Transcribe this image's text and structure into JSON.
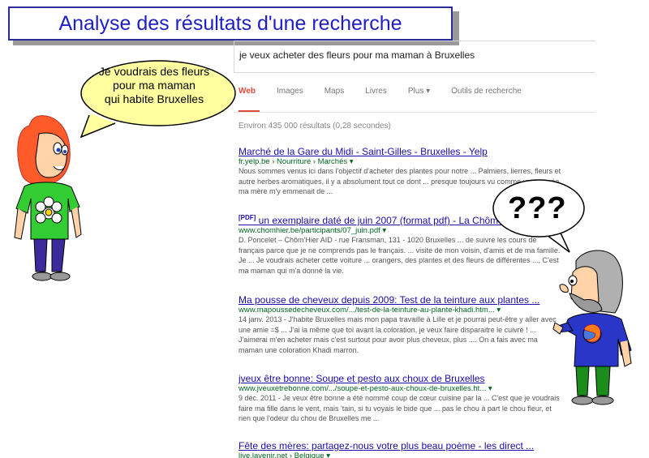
{
  "title": "Analyse des résultats d'une recherche",
  "search": {
    "query": "je veux acheter des fleurs pour ma maman à Bruxelles",
    "tabs": [
      "Web",
      "Images",
      "Maps",
      "Livres",
      "Plus ▾",
      "Outils de recherche"
    ],
    "stats": "Environ 435 000 résultats (0,28 secondes)"
  },
  "results": [
    {
      "title": "Marché de la Gare du Midi - Saint-Gilles - Bruxelles - Yelp",
      "url": "fr.yelp.be › Nourriture › Marchés ▾",
      "snippet": "Nous sommes venus ici dans l'objectif d'acheter des plantes pour notre ... Palmiers, lierres, fleurs et autre herbes aromatiques, il y a absolument tout ce dont ... presque toujours vu comme une corvée, ma mère m'y emmenait de ..."
    },
    {
      "badge": "[PDF]",
      "title": "un exemplaire daté de juin 2007 (format pdf) - La Chôm'Hier",
      "url": "www.chomhier.be/participants/07_juin.pdf ▾",
      "snippet": "D. Poncelet – Chôm'Hier AID - rue Fransman, 131 - 1020 Bruxelles ... de suivre les cours de français parce que je ne comprends pas le français. ... visite de mon voisin, d'amis et de ma famille. Je ... Je voudrais acheter cette voiture ... orangers, des plantes et des fleurs de différentes ..., C'est ma maman qui m'a donné la vie."
    },
    {
      "title": "Ma pousse de cheveux depuis 2009: Test de la teinture aux plantes ...",
      "url": "www.mapoussedecheveux.com/.../test-de-la-teinture-au-plante-khadi.htm... ▾",
      "snippet": "14 janv. 2013 - J'habite Bruxelles mais mon papa travaille à Lille et je pourrai peut-être y aller avec une amie =$ ... J'ai la même que toi avant la coloration, je veux faire disparaitre le cuivré ! ... J'aimerai m'en acheter mais c'est surtout pour avoir plus cheveux, plus .... On a fais avec ma maman une coloration Khadi marron."
    },
    {
      "title": "jveux être bonne: Soupe et pesto aux choux de Bruxelles",
      "url": "www.jveuxetrebonne.com/.../soupe-et-pesto-aux-choux-de-bruxelles.ht... ▾",
      "snippet": "9 déc. 2011 - Je veux être bonne a été nommé coup de cœur cuisine par la ... C'est que je voudrais faire ma fille dans le vent, mais 'tain, si tu voyais le bide que ... pas le chou à part le chou fleur, et rien que l'odeur du chou de Bruxelles me ..."
    },
    {
      "title": "Fête des mères: partagez-nous votre plus beau poème - les direct ...",
      "url": "live.lavenir.net › Belgique ▾",
      "snippet": ""
    }
  ],
  "bubble_left": [
    "Je voudrais des fleurs",
    "pour ma maman",
    "qui habite Bruxelles"
  ],
  "bubble_right": "???"
}
